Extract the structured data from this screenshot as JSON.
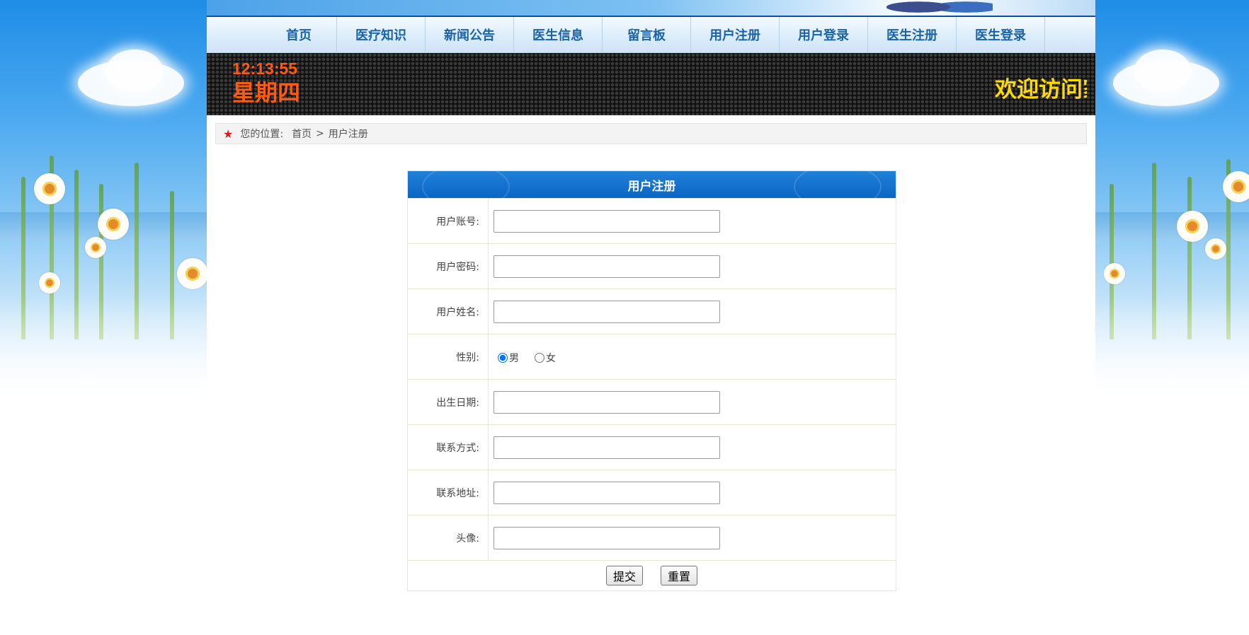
{
  "nav": {
    "items": [
      {
        "label": "首页"
      },
      {
        "label": "医疗知识"
      },
      {
        "label": "新闻公告"
      },
      {
        "label": "医生信息"
      },
      {
        "label": "留言板"
      },
      {
        "label": "用户注册"
      },
      {
        "label": "用户登录"
      },
      {
        "label": "医生注册"
      },
      {
        "label": "医生登录"
      }
    ]
  },
  "ticker": {
    "time": "12:13:55",
    "weekday": "星期四",
    "marquee": "欢迎访问家"
  },
  "breadcrumb": {
    "prefix": "您的位置:",
    "home": "首页",
    "separator": ">",
    "current": "用户注册"
  },
  "form": {
    "title": "用户注册",
    "fields": {
      "account": {
        "label": "用户账号:",
        "value": ""
      },
      "password": {
        "label": "用户密码:",
        "value": ""
      },
      "name": {
        "label": "用户姓名:",
        "value": ""
      },
      "gender": {
        "label": "性别:",
        "options": [
          "男",
          "女"
        ],
        "selected": "男"
      },
      "birthday": {
        "label": "出生日期:",
        "value": ""
      },
      "phone": {
        "label": "联系方式:",
        "value": ""
      },
      "address": {
        "label": "联系地址:",
        "value": ""
      },
      "avatar": {
        "label": "头像:",
        "value": ""
      }
    },
    "submit_label": "提交",
    "reset_label": "重置"
  },
  "colors": {
    "nav_text": "#1b63a8",
    "clock": "#ff5a12",
    "marquee": "#ffd900",
    "form_header": "#0a66c4",
    "breadcrumb_star": "#e01b1b"
  },
  "icons": {
    "breadcrumb": "star-icon"
  }
}
